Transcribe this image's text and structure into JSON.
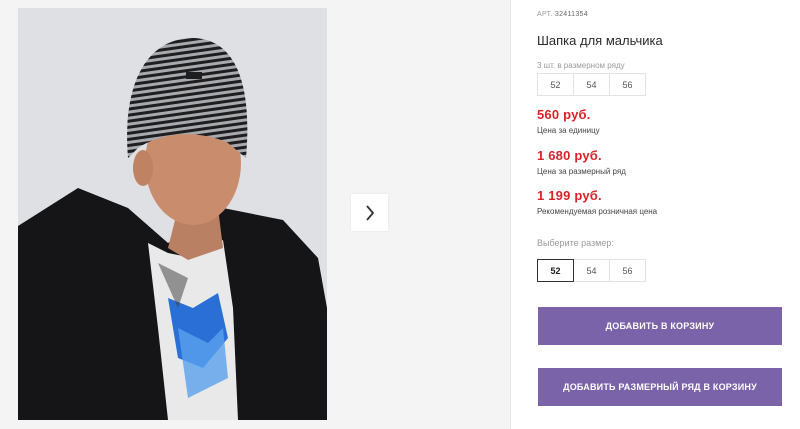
{
  "gallery": {
    "next_icon": "chevron-right-icon"
  },
  "product": {
    "article_prefix": "АРТ.",
    "article_number": "32411354",
    "title": "Шапка для мальчика",
    "set_note": "3 шт. в размерном ряду",
    "set_sizes": [
      "52",
      "54",
      "56"
    ],
    "prices": [
      {
        "value": "560 руб.",
        "label": "Цена за единицу"
      },
      {
        "value": "1 680 руб.",
        "label": "Цена за размерный ряд"
      },
      {
        "value": "1 199 руб.",
        "label": "Рекомендуемая розничная цена"
      }
    ],
    "choose_size_label": "Выберите размер:",
    "choose_sizes": [
      "52",
      "54",
      "56"
    ],
    "selected_size": "52"
  },
  "actions": {
    "add_to_cart": "ДОБАВИТЬ В КОРЗИНУ",
    "add_set_to_cart": "ДОБАВИТЬ РАЗМЕРНЫЙ РЯД В КОРЗИНУ"
  },
  "colors": {
    "price": "#d8232a",
    "button": "#7a63a8"
  }
}
